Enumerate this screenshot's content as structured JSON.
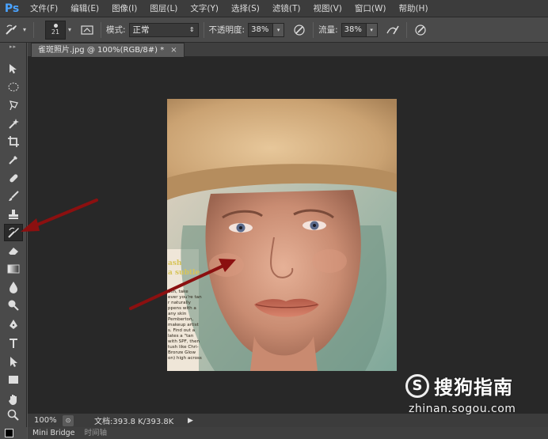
{
  "app": {
    "logo": "Ps"
  },
  "menu": [
    "文件(F)",
    "编辑(E)",
    "图像(I)",
    "图层(L)",
    "文字(Y)",
    "选择(S)",
    "滤镜(T)",
    "视图(V)",
    "窗口(W)",
    "帮助(H)"
  ],
  "options": {
    "brush_size": "21",
    "mode_label": "模式:",
    "mode_value": "正常",
    "opacity_label": "不透明度:",
    "opacity_value": "38%",
    "flow_label": "流量:",
    "flow_value": "38%"
  },
  "document": {
    "tab_title": "雀斑照片.jpg @ 100%(RGB/8#) *",
    "close_glyph": "×"
  },
  "status": {
    "zoom": "100%",
    "doc_info": "文档:393.8 K/393.8K",
    "arrow_glyph": "▶"
  },
  "panels": {
    "mini_bridge": "Mini Bridge",
    "timeline": "时间轴"
  },
  "magazine_text": {
    "heading": [
      "ash",
      "a subtle"
    ],
    "body": [
      "ush, take",
      "ever you're tan",
      "r naturally",
      "ppens with a",
      "any skin",
      "Pemberton,",
      "makeup artist",
      "s. Find out a",
      "lates a \"tan",
      "with SPF, then",
      "tush like Chri-",
      "Bronze Glow",
      "on) high across"
    ]
  },
  "watermark": {
    "circle_letter": "S",
    "brand": "搜狗指南",
    "url": "zhinan.sogou.com"
  },
  "colors": {
    "arrow": "#8b1010",
    "logo": "#4aa3ff",
    "foreground_swatch": "#000000"
  },
  "icons": {
    "toolbar": [
      "move-icon",
      "marquee-icon",
      "lasso-icon",
      "magic-wand-icon",
      "crop-icon",
      "eyedropper-icon",
      "healing-brush-icon",
      "brush-icon",
      "clone-stamp-icon",
      "history-brush-icon",
      "eraser-icon",
      "gradient-icon",
      "blur-icon",
      "dodge-icon",
      "pen-icon",
      "type-icon",
      "path-select-icon",
      "rectangle-icon",
      "hand-icon",
      "zoom-icon"
    ]
  }
}
